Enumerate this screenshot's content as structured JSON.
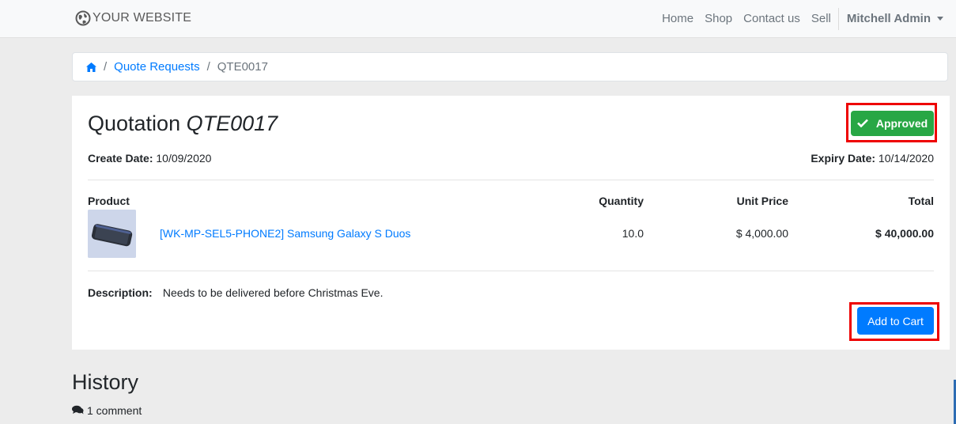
{
  "navbar": {
    "brand": "YOUR WEBSITE",
    "links": [
      "Home",
      "Shop",
      "Contact us",
      "Sell"
    ],
    "user": "Mitchell Admin"
  },
  "breadcrumb": {
    "home_icon": "home-icon",
    "quote_requests": "Quote Requests",
    "current": "QTE0017",
    "sep": "/"
  },
  "quotation": {
    "title_prefix": "Quotation",
    "number": "QTE0017",
    "status": "Approved",
    "status_color": "#28a745",
    "create_date_label": "Create Date:",
    "create_date": "10/09/2020",
    "expiry_date_label": "Expiry Date:",
    "expiry_date": "10/14/2020",
    "columns": [
      "Product",
      "Quantity",
      "Unit Price",
      "Total"
    ],
    "lines": [
      {
        "product": "[WK-MP-SEL5-PHONE2] Samsung Galaxy S Duos",
        "quantity": "10.0",
        "unit_price": "$ 4,000.00",
        "total": "$ 40,000.00"
      }
    ],
    "description_label": "Description:",
    "description": "Needs to be delivered before Christmas Eve.",
    "add_to_cart": "Add to Cart"
  },
  "history": {
    "title": "History",
    "comments": "1 comment"
  },
  "colors": {
    "link": "#007bff",
    "primary": "#007bff",
    "highlight_frame": "#ee0000"
  }
}
